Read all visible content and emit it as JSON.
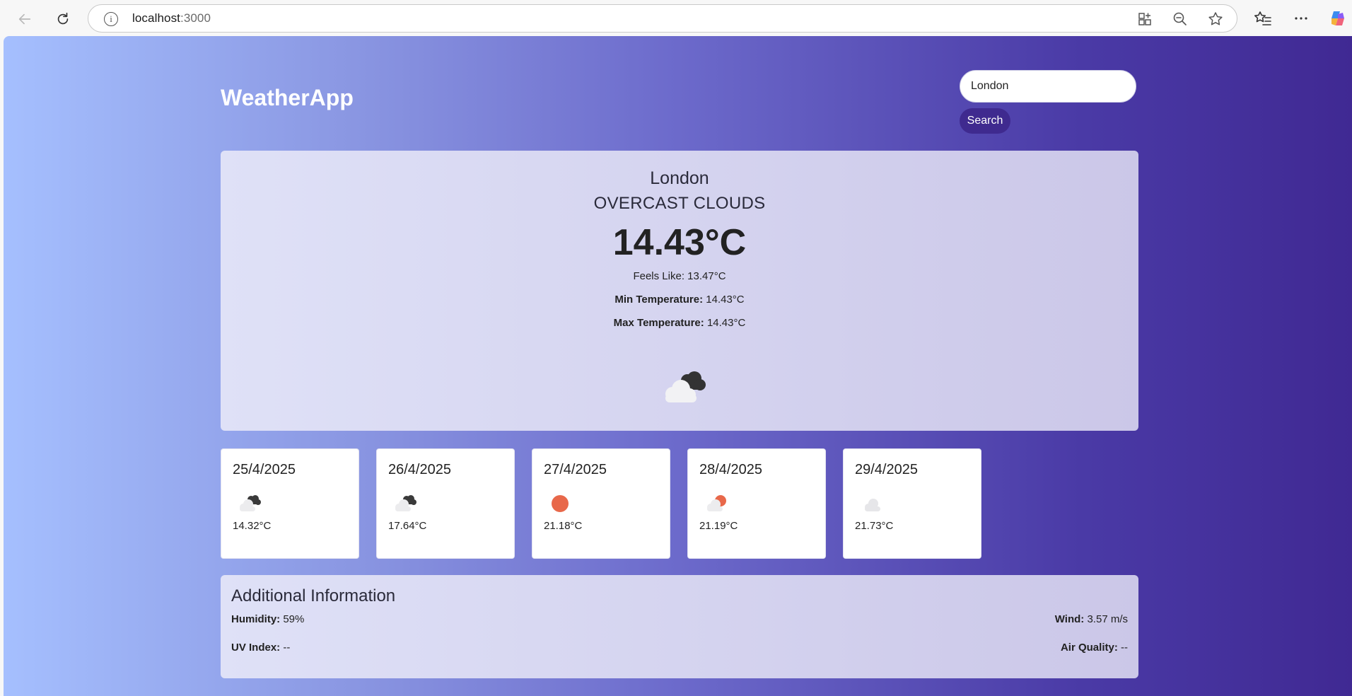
{
  "browser": {
    "url_host": "localhost",
    "url_port": ":3000"
  },
  "app": {
    "brand": "WeatherApp",
    "search": {
      "value": "London",
      "button_label": "Search"
    }
  },
  "current": {
    "city": "London",
    "description": "OVERCAST CLOUDS",
    "temperature": "14.43°C",
    "feels_like": "Feels Like: 13.47°C",
    "min_label": "Min Temperature:",
    "min_value": "14.43°C",
    "max_label": "Max Temperature:",
    "max_value": "14.43°C",
    "icon": "overcast-clouds-icon"
  },
  "forecast": [
    {
      "date": "25/4/2025",
      "temp": "14.32°C",
      "icon": "broken-clouds-icon"
    },
    {
      "date": "26/4/2025",
      "temp": "17.64°C",
      "icon": "broken-clouds-icon"
    },
    {
      "date": "27/4/2025",
      "temp": "21.18°C",
      "icon": "clear-sky-icon"
    },
    {
      "date": "28/4/2025",
      "temp": "21.19°C",
      "icon": "few-clouds-icon"
    },
    {
      "date": "29/4/2025",
      "temp": "21.73°C",
      "icon": "scattered-clouds-icon"
    }
  ],
  "additional": {
    "title": "Additional Information",
    "humidity_label": "Humidity:",
    "humidity_value": "59%",
    "wind_label": "Wind:",
    "wind_value": "3.57 m/s",
    "uv_label": "UV Index:",
    "uv_value": "--",
    "air_label": "Air Quality:",
    "air_value": "--"
  },
  "colors": {
    "accent": "#3f2a8f",
    "sun": "#e8684a"
  }
}
